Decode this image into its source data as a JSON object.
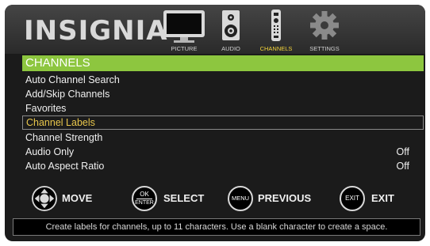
{
  "brand": {
    "logo_text": "INSIGNIA"
  },
  "tabs": [
    {
      "label": "PICTURE",
      "icon": "tv-icon",
      "active": false
    },
    {
      "label": "AUDIO",
      "icon": "speaker-icon",
      "active": false
    },
    {
      "label": "CHANNELS",
      "icon": "remote-icon",
      "active": true
    },
    {
      "label": "SETTINGS",
      "icon": "gear-icon",
      "active": false
    }
  ],
  "menu": {
    "title": "CHANNELS",
    "items": [
      {
        "label": "Auto Channel Search",
        "value": ""
      },
      {
        "label": "Add/Skip Channels",
        "value": ""
      },
      {
        "label": "Favorites",
        "value": ""
      },
      {
        "label": "Channel Labels",
        "value": "",
        "selected": true
      },
      {
        "label": "Channel Strength",
        "value": ""
      },
      {
        "label": "Audio Only",
        "value": "Off"
      },
      {
        "label": "Auto Aspect Ratio",
        "value": "Off"
      }
    ]
  },
  "footer": {
    "move": {
      "label": "MOVE"
    },
    "select": {
      "label": "SELECT",
      "key_top": "OK",
      "key_bottom": "ENTER"
    },
    "previous": {
      "label": "PREVIOUS",
      "key": "MENU"
    },
    "exit": {
      "label": "EXIT",
      "key": "EXIT"
    }
  },
  "help_text": "Create labels for channels, up to 11 characters. Use a blank character to create a space.",
  "colors": {
    "accent": "#8dc63f",
    "selected_text": "#e8c64c",
    "background": "#1b1b1b"
  }
}
